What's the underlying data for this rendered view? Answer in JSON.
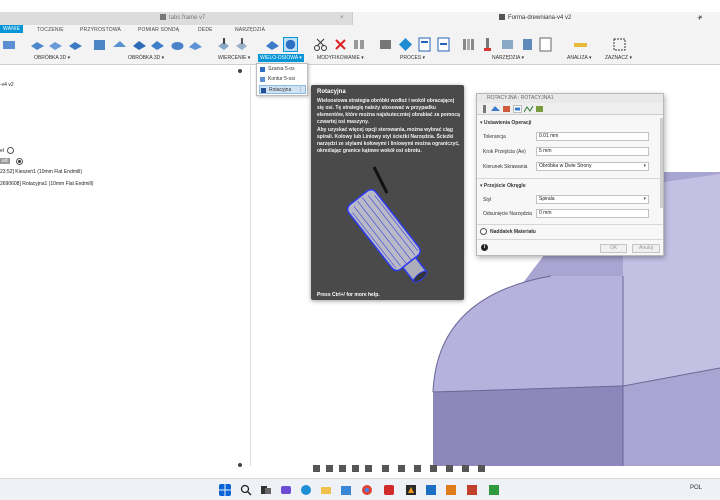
{
  "doc_tabs": [
    {
      "title": "tabs frame v7",
      "close": "×"
    },
    {
      "title": "Forma-drewniana-v4 v2",
      "close": "×"
    }
  ],
  "new_tab": "+",
  "ribbon": {
    "tabs": [
      "WANIE",
      "TOCZENIE",
      "PRZYROSTOWA",
      "POMIAR SONDĄ",
      "DEDE",
      "NARZĘDZIA"
    ],
    "groups": [
      "OBRÓBKA 2D ▾",
      "OBRÓBKA 3D ▾",
      "WIERCENIE ▾",
      "WIELO-OSIOWA ▾",
      "MODYFIKOWANIE ▾",
      "PROCES ▾",
      "NARZĘDZIA ▾",
      "ANALIZA ▾",
      "ZAZNACZ ▾"
    ]
  },
  "browser": {
    "path_label": "-v4 v2",
    "row_1": "el",
    "row_2": "ed",
    "row_3": "23:52] Kieszeń1 (10mm Flat Endmill)",
    "row_4": "2690608] Rotacyjna1 (10mm Flat Endmill)"
  },
  "multiaxis_menu": {
    "items": [
      "Szarsa 5-os",
      "Kontur 5-osi",
      "Rotacyjna"
    ],
    "more": "⋮"
  },
  "tooltip": {
    "title": "Rotacyjna",
    "para1": "Wieloosiowa strategia obróbki wzdłuż i wokół obracającej się osi. Tę strategię należy stosować w przypadku elementów, które można najskuteczniej obrabiać za pomocą czwartej osi maszyny.",
    "para2": "Aby uzyskać więcej opcji sterowania, można wybrać ciąg spirali. Kołowy lub Liniowy styl ścieżki Narzędzia. Ścieżki narzędzi ze stylami kołowymi i liniowymi można ograniczyć, określając granice kątowe wokół osi obrotu.",
    "footer": "Press Ctrl+/ for more help."
  },
  "dialog": {
    "title": "ROTACYJNA : ROTACYJNA1",
    "section_operation": "Ustawienia Operacji",
    "tolerance_label": "Tolerancja",
    "tolerance_value": "0.01 mm",
    "stepover_label": "Krok Przejścia (Ae)",
    "stepover_value": "5 mm",
    "direction_label": "Kierunek Skrawania",
    "direction_value": "Obróbka w Dwie Strony",
    "section_pass": "Przejście Okręgle",
    "style_label": "Styl",
    "style_value": "Spirala",
    "offset_label": "Odsunięcie Narzędzia",
    "offset_value": "0 mm",
    "section_stock": "Naddatek Materiału",
    "ok": "OK",
    "cancel": "Anuluj",
    "info": "i",
    "caret": "▾"
  },
  "taskbar": {
    "tray": "POL"
  },
  "colors": {
    "accent": "#0696d7",
    "part_face": "#b9b5dc",
    "part_side": "#8a86b8"
  }
}
